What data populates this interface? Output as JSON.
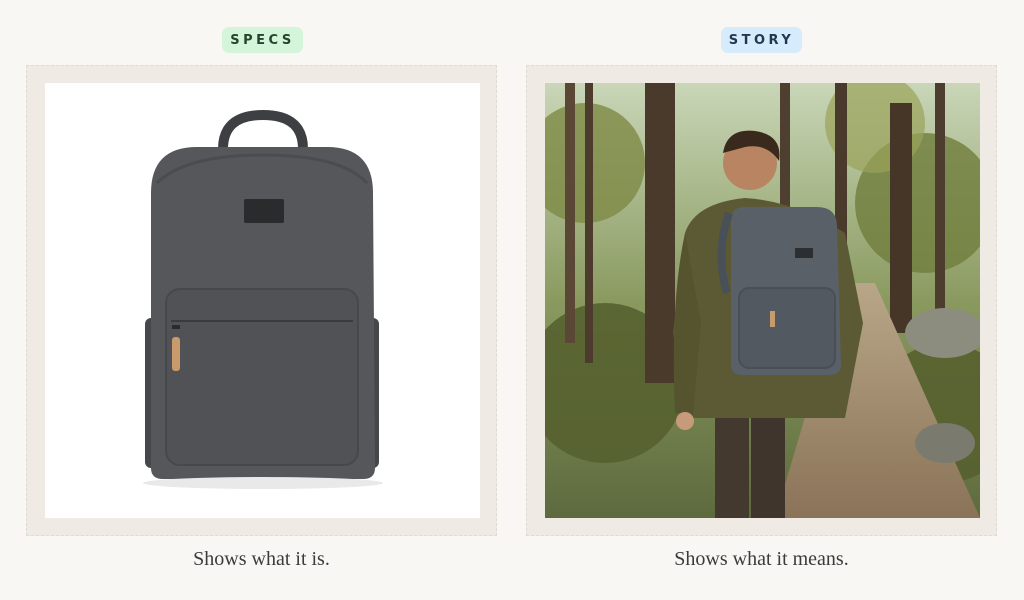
{
  "left_panel": {
    "badge": "SPECS",
    "caption": "Shows what it is.",
    "image": "product-backpack-photo"
  },
  "right_panel": {
    "badge": "STORY",
    "caption": "Shows what it means.",
    "image": "hiker-with-backpack-forest-photo"
  },
  "colors": {
    "background": "#f8f7f4",
    "frame": "#efebe4",
    "specs_badge": "#d4f5d9",
    "story_badge": "#d6ebfb"
  }
}
